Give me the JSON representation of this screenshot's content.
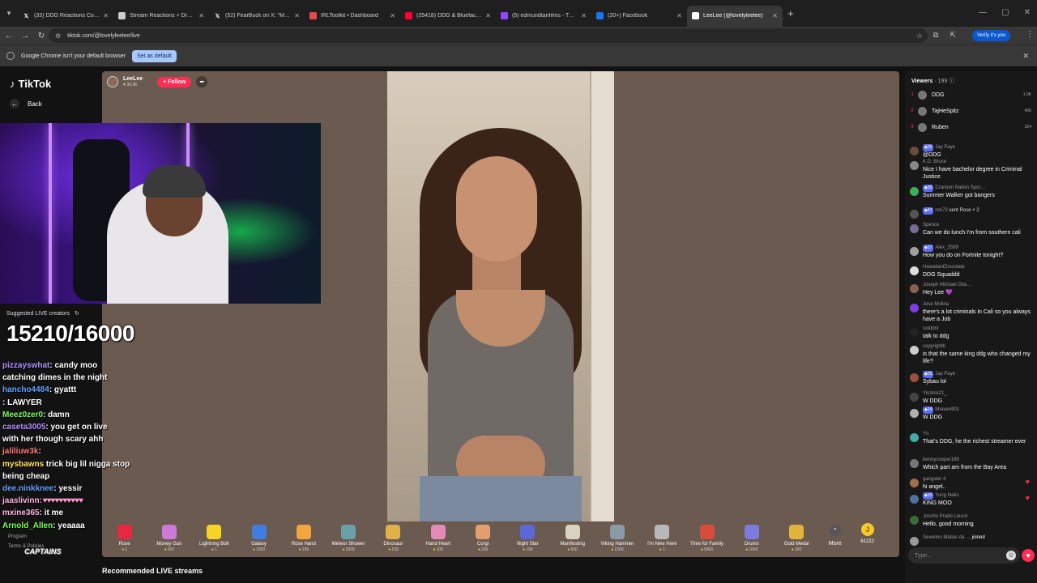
{
  "tabs": [
    {
      "label": "(33) DDG Reactions Communi…",
      "icon": "x-logo-icon",
      "color": "#ffffff"
    },
    {
      "label": "Stream Reactions + Drama | Co…",
      "icon": "site-icon",
      "color": "#cccccc"
    },
    {
      "label": "(52) FearBuck on X: \"Marlon wa…",
      "icon": "x-logo-icon",
      "color": "#ffffff"
    },
    {
      "label": "IRLToolkit • Dashboard",
      "icon": "irltoolkit-icon",
      "color": "#e64a4a"
    },
    {
      "label": "(25418) DDG & Blueface - Hab…",
      "icon": "youtube-icon",
      "color": "#ff0033"
    },
    {
      "label": "(5) edmundtanfilms - Twitch",
      "icon": "twitch-icon",
      "color": "#9146ff"
    },
    {
      "label": "(20+) Facebook",
      "icon": "facebook-icon",
      "color": "#1877f2"
    },
    {
      "label": "LeeLee (@lovelyleelee)",
      "icon": "tiktok-icon",
      "color": "#ffffff",
      "active": true
    }
  ],
  "address": {
    "url": "tiktok.com/@lovelyleelee/live",
    "verify_label": "Verify it's you"
  },
  "infobar": {
    "message": "Google Chrome isn't your default browser",
    "button": "Set as default"
  },
  "sidebar": {
    "brand": "TikTok",
    "back": "Back",
    "suggested_title": "Suggested LIVE creators",
    "footer": [
      "Program",
      "Terms & Policies"
    ]
  },
  "overlay": {
    "goal": "15210/16000",
    "brand_logo": "CAPTAINS",
    "chat": [
      {
        "user": "pizzayswhat",
        "text": ": candy moo",
        "color": "cc-purple"
      },
      {
        "user": "",
        "text": "catching dimes in the night",
        "color": ""
      },
      {
        "user": "hancho4484",
        "text": ": gyattt",
        "color": "cc-blue"
      },
      {
        "user": "",
        "text": ": LAWYER",
        "color": ""
      },
      {
        "user": "Meez0zer0",
        "text": ": damn",
        "color": "cc-green"
      },
      {
        "user": "caseta3005",
        "text": ": you get on live",
        "color": "cc-purple"
      },
      {
        "user": "",
        "text": "with her though scary ahh",
        "color": ""
      },
      {
        "user": "jaliliuw3k",
        "text": ": ",
        "color": "cc-red"
      },
      {
        "user": "mysbawns",
        "text": " trick big lil nigga stop",
        "color": "cc-yellow"
      },
      {
        "user": "",
        "text": "being cheap",
        "color": ""
      },
      {
        "user": "dee.ninkknee",
        "text": ": yessir",
        "color": "cc-blue"
      },
      {
        "user": "jaaslivinn",
        "text": ": ♥♥♥♥♥♥♥♥♥♥",
        "color": "cc-pink"
      },
      {
        "user": "mxine365",
        "text": ": it me",
        "color": "cc-pink"
      },
      {
        "user": "Arnold_Allen",
        "text": ": yeaaaa",
        "color": "cc-green"
      }
    ]
  },
  "live": {
    "host_name": "LeeLee",
    "host_likes": "30.3K",
    "follow": "+ Follow",
    "recommended": "Recommended LIVE streams"
  },
  "gifts": [
    {
      "name": "Rose",
      "price": "1",
      "color": "#e8283f"
    },
    {
      "name": "Money Gun",
      "price": "500",
      "color": "#c97bd6"
    },
    {
      "name": "Lightning Bolt",
      "price": "1",
      "color": "#f6d423"
    },
    {
      "name": "Galaxy",
      "price": "1000",
      "color": "#3f7de0"
    },
    {
      "name": "Rose Hand",
      "price": "199",
      "color": "#f2a53c"
    },
    {
      "name": "Meteor Shower",
      "price": "3000",
      "color": "#6aa0a8"
    },
    {
      "name": "Dinosaur",
      "price": "199",
      "color": "#e2b04a"
    },
    {
      "name": "Hand Heart",
      "price": "100",
      "color": "#e38ab8"
    },
    {
      "name": "Corgi",
      "price": "299",
      "color": "#e2a070"
    },
    {
      "name": "Night Star",
      "price": "199",
      "color": "#5c67d8"
    },
    {
      "name": "Manifesting",
      "price": "500",
      "color": "#d9d2c0"
    },
    {
      "name": "Viking Hammer",
      "price": "1500",
      "color": "#8b9aa8"
    },
    {
      "name": "I'm New Here",
      "price": "1",
      "color": "#b8b8b8"
    },
    {
      "name": "Time for Family",
      "price": "5000",
      "color": "#d84c3e"
    },
    {
      "name": "Drums",
      "price": "1000",
      "color": "#7c7ce0"
    },
    {
      "name": "Gold Medal",
      "price": "300",
      "color": "#e0b43a"
    }
  ],
  "gift_more": "More",
  "coins": "61222",
  "viewers": {
    "title": "Viewers",
    "count": "199",
    "top": [
      {
        "rank": "1",
        "name": "DDG",
        "score": "1.0K"
      },
      {
        "rank": "2",
        "name": "TajHeSpitz",
        "score": "406"
      },
      {
        "rank": "3",
        "name": "Ruben",
        "score": "324"
      }
    ]
  },
  "livechat": [
    {
      "user": "Jay Paye",
      "text": "@DDG",
      "lvl": "25"
    },
    {
      "user": "K.D. Bruce",
      "text": "Nice I have bachelor degree in Criminal Justice",
      "lvl": ""
    },
    {
      "user": "Cranium Nation Spor…",
      "text": "Summer Walker got bangers",
      "lvl": "30"
    },
    {
      "user": "ron73",
      "text": "sent Rose × 2",
      "lvl": "47",
      "sent": true
    },
    {
      "user": "Spence",
      "text": "Can we do lunch I'm from southern cali",
      "lvl": ""
    },
    {
      "user": "Alex_2599",
      "text": "How you do on Fortnite tonight?",
      "lvl": "17"
    },
    {
      "user": "HawaiianChocolate",
      "text": "DDG Squaddd",
      "lvl": ""
    },
    {
      "user": "Joseph Michael Gila…",
      "text": "Hey Lee 💜",
      "lvl": ""
    },
    {
      "user": "Jose Molina",
      "text": "there's a lot criminals in Cali so you always have a Job",
      "lvl": ""
    },
    {
      "user": "sotddnl",
      "text": "talk to ddg",
      "lvl": ""
    },
    {
      "user": "copyrightK",
      "text": "is that the same king ddg who changed my life?",
      "lvl": ""
    },
    {
      "user": "Jay Paye",
      "text": "Sybau lol",
      "lvl": "25"
    },
    {
      "user": "Ykchris21_",
      "text": "W DDG",
      "lvl": ""
    },
    {
      "user": "bhaven901",
      "text": "W DDG",
      "lvl": "14"
    },
    {
      "user": "Yn",
      "text": "That's DDG, he the richest streamer ever",
      "lvl": ""
    },
    {
      "user": "bennycooper186",
      "text": "Which part am from the Bay Area",
      "lvl": ""
    },
    {
      "user": "gangster 4",
      "text": "hi angel..",
      "lvl": "",
      "heart": true
    },
    {
      "user": "Yung Natis",
      "text": "KING MOO",
      "lvl": "10",
      "heart": true
    },
    {
      "user": "Joscho Prado Lourol",
      "text": "Hello, good morning",
      "lvl": ""
    },
    {
      "user": "Severino Matias da …",
      "text": "joined",
      "lvl": "",
      "joined": true
    }
  ],
  "chat_placeholder": "Type..."
}
